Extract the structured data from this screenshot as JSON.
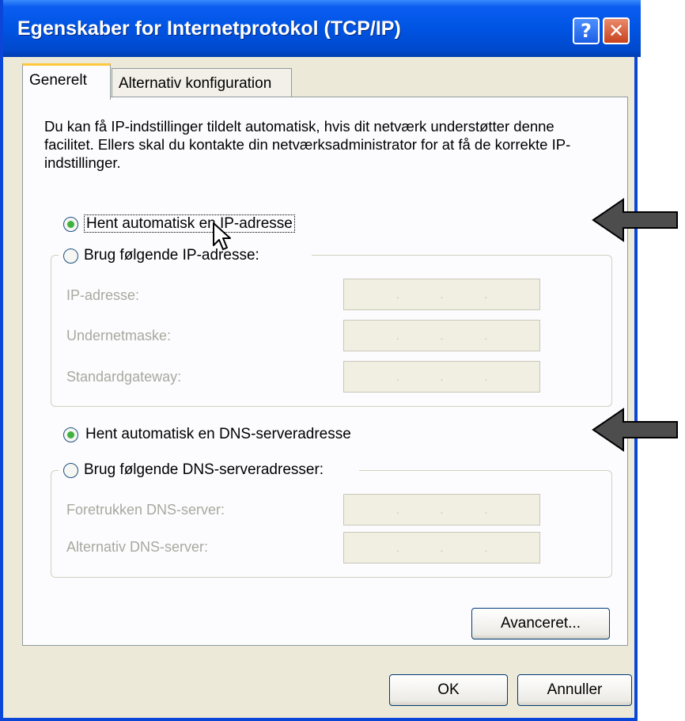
{
  "window": {
    "title": "Egenskaber for Internetprotokol (TCP/IP)",
    "help_glyph": "?",
    "close_glyph": "✕"
  },
  "tabs": [
    {
      "label": "Generelt"
    },
    {
      "label": "Alternativ konfiguration"
    }
  ],
  "intro_text": "Du kan få IP-indstillinger tildelt automatisk, hvis dit netværk understøtter denne facilitet. Ellers skal du kontakte din netværksadministrator for at få de korrekte IP-indstillinger.",
  "ip": {
    "auto_label": "Hent automatisk en IP-adresse",
    "manual_label": "Brug følgende IP-adresse:",
    "selected": "auto",
    "fields": [
      {
        "label": "IP-adresse:"
      },
      {
        "label": "Undernetmaske:"
      },
      {
        "label": "Standardgateway:"
      }
    ]
  },
  "dns": {
    "auto_label": "Hent automatisk en DNS-serveradresse",
    "manual_label": "Brug følgende DNS-serveradresser:",
    "selected": "auto",
    "fields": [
      {
        "label": "Foretrukken DNS-server:"
      },
      {
        "label": "Alternativ DNS-server:"
      }
    ]
  },
  "ip_dot": ".",
  "buttons": {
    "advanced": "Avanceret...",
    "ok": "OK",
    "cancel": "Annuller"
  },
  "colors": {
    "titlebar": "#0054e3",
    "dialog_bg": "#ece9d8",
    "radio_dot": "#3fb23f",
    "arrow": "#4d4d4d"
  },
  "icons": {
    "cursor": "mouse-pointer-icon",
    "annotation": "left-arrow-icon"
  }
}
